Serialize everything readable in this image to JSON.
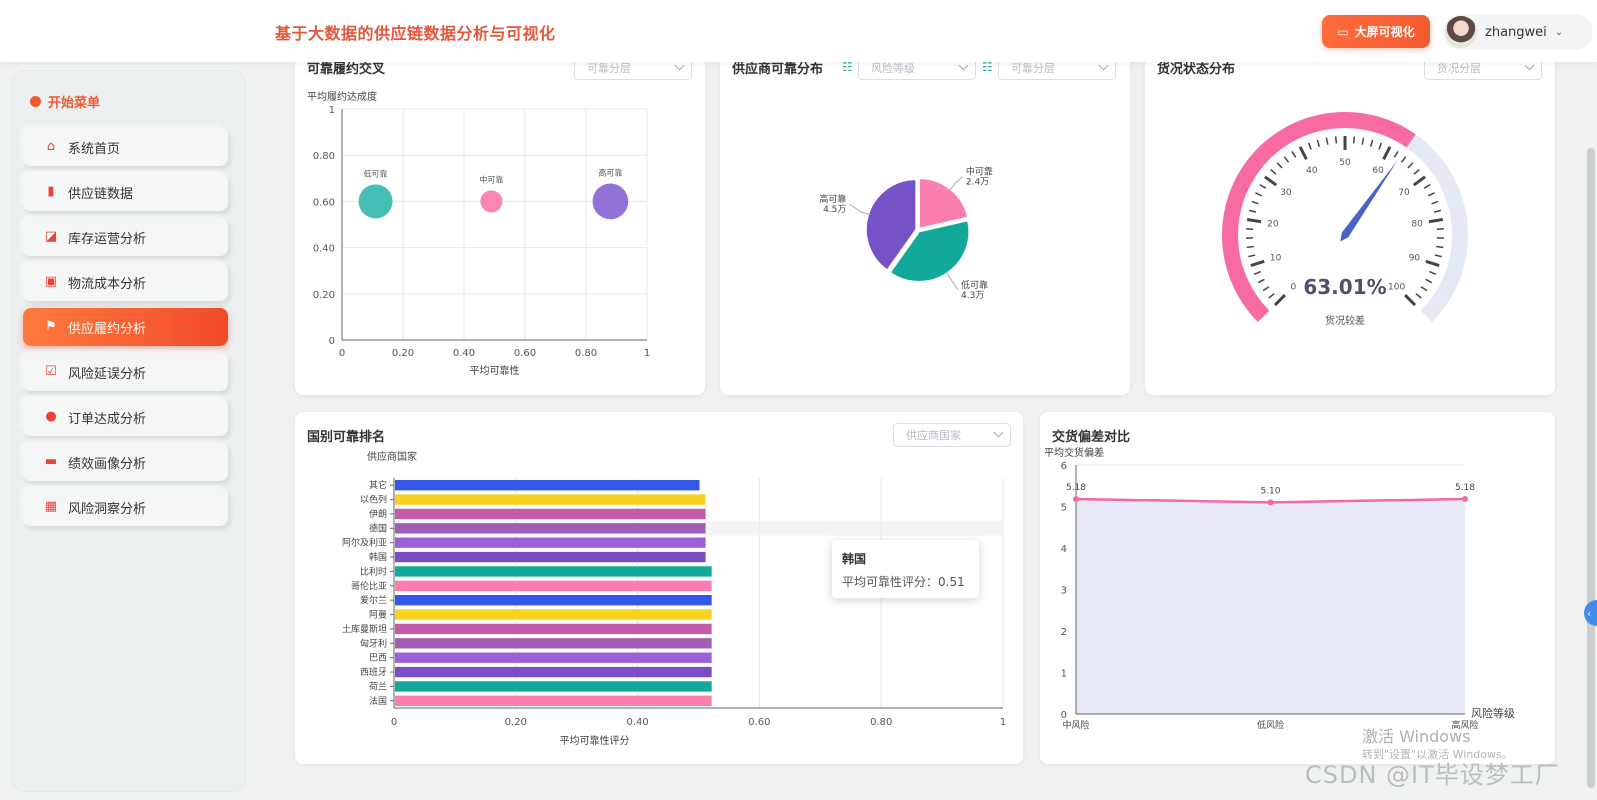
{
  "header": {
    "title": "基于大数据的供应链数据分析与可视化",
    "bigscreen_label": "大屏可视化",
    "username": "zhangwei"
  },
  "sidebar": {
    "heading": "开始菜单",
    "items": [
      {
        "label": "系统首页",
        "icon": "home-icon",
        "glyph": "⌂"
      },
      {
        "label": "供应链数据",
        "icon": "bar-chart-icon",
        "glyph": "▮"
      },
      {
        "label": "库存运营分析",
        "icon": "trend-chart-icon",
        "glyph": "◪"
      },
      {
        "label": "物流成本分析",
        "icon": "clipboard-icon",
        "glyph": "▣"
      },
      {
        "label": "供应履约分析",
        "icon": "flag-icon",
        "glyph": "⚑",
        "active": true
      },
      {
        "label": "风险延误分析",
        "icon": "checklist-icon",
        "glyph": "☑"
      },
      {
        "label": "订单达成分析",
        "icon": "pin-icon",
        "glyph": "●"
      },
      {
        "label": "绩效画像分析",
        "icon": "wallet-icon",
        "glyph": "▬"
      },
      {
        "label": "风险洞察分析",
        "icon": "grid-icon",
        "glyph": "▦"
      }
    ]
  },
  "card1": {
    "title": "可靠履约交叉",
    "select_placeholder": "可靠分层",
    "chart_data": {
      "type": "scatter",
      "ylabel": "平均履约达成度",
      "xlabel": "平均可靠性",
      "xlim": [
        0,
        1
      ],
      "ylim": [
        0,
        1
      ],
      "xticks": [
        "0",
        "0.20",
        "0.40",
        "0.60",
        "0.80",
        "1"
      ],
      "yticks": [
        "0",
        "0.20",
        "0.40",
        "0.60",
        "0.80",
        "1"
      ],
      "points": [
        {
          "name": "低可靠",
          "x": 0.11,
          "y": 0.6,
          "size": 1.0,
          "color": "#3bbcb0"
        },
        {
          "name": "中可靠",
          "x": 0.49,
          "y": 0.6,
          "size": 0.65,
          "color": "#fb7fae"
        },
        {
          "name": "高可靠",
          "x": 0.88,
          "y": 0.6,
          "size": 1.05,
          "color": "#8a6ad6"
        }
      ]
    }
  },
  "card2": {
    "title": "供应商可靠分布",
    "select1_placeholder": "风险等级",
    "select2_placeholder": "可靠分层",
    "chart_data": {
      "type": "pie",
      "slices": [
        {
          "name": "中可靠",
          "value_label": "2.4万",
          "value": 2.4,
          "color": "#fb7fae"
        },
        {
          "name": "低可靠",
          "value_label": "4.3万",
          "value": 4.3,
          "color": "#12a99b"
        },
        {
          "name": "高可靠",
          "value_label": "4.5万",
          "value": 4.5,
          "color": "#7552c5"
        }
      ]
    }
  },
  "card3": {
    "title": "货况状态分布",
    "select_placeholder": "货况分层",
    "gauge": {
      "value": 63.01,
      "value_label": "63.01%",
      "status": "货况较差",
      "ticks": [
        "0",
        "10",
        "20",
        "30",
        "40",
        "50",
        "60",
        "70",
        "80",
        "90",
        "100"
      ]
    }
  },
  "card4": {
    "title": "国别可靠排名",
    "select_placeholder": "供应商国家",
    "chart_data": {
      "type": "bar",
      "orientation": "horizontal",
      "ylabel": "供应商国家",
      "xlabel": "平均可靠性评分",
      "xlim": [
        0,
        1
      ],
      "xticks": [
        "0",
        "0.20",
        "0.40",
        "0.60",
        "0.80",
        "1"
      ],
      "categories": [
        "其它",
        "以色列",
        "伊朗",
        "德国",
        "阿尔及利亚",
        "韩国",
        "比利时",
        "哥伦比亚",
        "爱尔兰",
        "阿曼",
        "土库曼斯坦",
        "匈牙利",
        "巴西",
        "西班牙",
        "荷兰",
        "法国"
      ],
      "values": [
        0.5,
        0.51,
        0.51,
        0.51,
        0.51,
        0.51,
        0.52,
        0.52,
        0.52,
        0.52,
        0.52,
        0.52,
        0.52,
        0.52,
        0.52,
        0.52
      ],
      "colors": [
        "#3358e8",
        "#f8d21c",
        "#c55aa8",
        "#a25db5",
        "#9b62d8",
        "#7a4fc4",
        "#12a99b",
        "#fb7fae",
        "#3358e8",
        "#f8d21c",
        "#c55aa8",
        "#a25db5",
        "#9b62d8",
        "#7a4fc4",
        "#12a99b",
        "#fb7fae"
      ]
    },
    "tooltip": {
      "name": "韩国",
      "line": "平均可靠性评分：0.51"
    }
  },
  "card5": {
    "title": "交货偏差对比",
    "chart_data": {
      "type": "line",
      "ylabel": "平均交货偏差",
      "xlabel": "风险等级",
      "ylim": [
        0,
        6
      ],
      "yticks": [
        "0",
        "1",
        "2",
        "3",
        "4",
        "5",
        "6"
      ],
      "categories": [
        "中风险",
        "低风险",
        "高风险"
      ],
      "values": [
        5.18,
        5.1,
        5.18
      ],
      "value_labels": [
        "5.18",
        "5.10",
        "5.18"
      ],
      "color": "#f06aa8"
    }
  },
  "watermark": {
    "line1": "激活 Windows",
    "line2": "转到\"设置\"以激活 Windows。",
    "line3": "CSDN @IT毕设梦工厂"
  }
}
